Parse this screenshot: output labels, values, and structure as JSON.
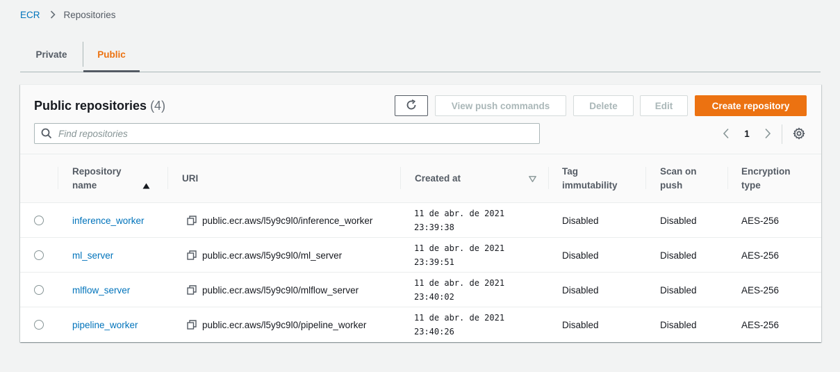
{
  "breadcrumb": {
    "root": "ECR",
    "current": "Repositories"
  },
  "tabs": [
    {
      "label": "Private",
      "active": false
    },
    {
      "label": "Public",
      "active": true
    }
  ],
  "panel": {
    "title": "Public repositories",
    "count": "(4)",
    "buttons": {
      "view_push": "View push commands",
      "delete": "Delete",
      "edit": "Edit",
      "create": "Create repository"
    },
    "search_placeholder": "Find repositories",
    "page": "1"
  },
  "columns": {
    "name_line1": "Repository",
    "name_line2": "name",
    "uri": "URI",
    "created": "Created at",
    "tag_line1": "Tag",
    "tag_line2": "immutability",
    "scan_line1": "Scan on",
    "scan_line2": "push",
    "enc_line1": "Encryption",
    "enc_line2": "type"
  },
  "rows": [
    {
      "name": "inference_worker",
      "uri": "public.ecr.aws/l5y9c9l0/inference_worker",
      "date": "11 de abr. de 2021",
      "time": "23:39:38",
      "tag": "Disabled",
      "scan": "Disabled",
      "enc": "AES-256"
    },
    {
      "name": "ml_server",
      "uri": "public.ecr.aws/l5y9c9l0/ml_server",
      "date": "11 de abr. de 2021",
      "time": "23:39:51",
      "tag": "Disabled",
      "scan": "Disabled",
      "enc": "AES-256"
    },
    {
      "name": "mlflow_server",
      "uri": "public.ecr.aws/l5y9c9l0/mlflow_server",
      "date": "11 de abr. de 2021",
      "time": "23:40:02",
      "tag": "Disabled",
      "scan": "Disabled",
      "enc": "AES-256"
    },
    {
      "name": "pipeline_worker",
      "uri": "public.ecr.aws/l5y9c9l0/pipeline_worker",
      "date": "11 de abr. de 2021",
      "time": "23:40:26",
      "tag": "Disabled",
      "scan": "Disabled",
      "enc": "AES-256"
    }
  ],
  "colors": {
    "link": "#0073bb",
    "accent": "#ec7211",
    "text": "#16191f",
    "muted": "#545b64"
  }
}
